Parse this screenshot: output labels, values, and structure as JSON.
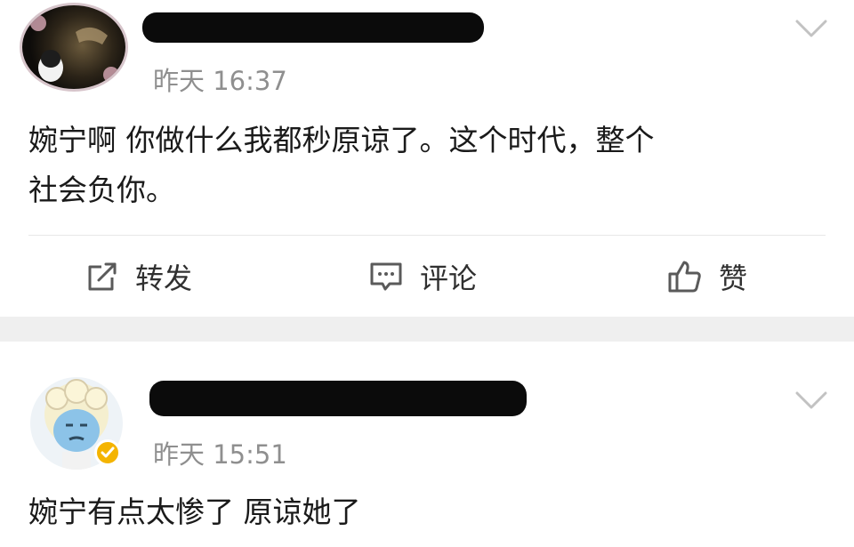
{
  "feed": {
    "posts": [
      {
        "time": "昨天 16:37",
        "content_line1": "婉宁啊 你做什么我都秒原谅了。这个时代，整个",
        "content_line2": "社会负你。",
        "actions": {
          "repost": "转发",
          "comment": "评论",
          "like": "赞"
        }
      },
      {
        "time": "昨天 15:51",
        "content": "婉宁有点太惨了 原谅她了"
      }
    ]
  },
  "colors": {
    "divider_band": "#efefef",
    "verified_badge": "#f4b400",
    "timestamp": "#8f8f8f"
  }
}
